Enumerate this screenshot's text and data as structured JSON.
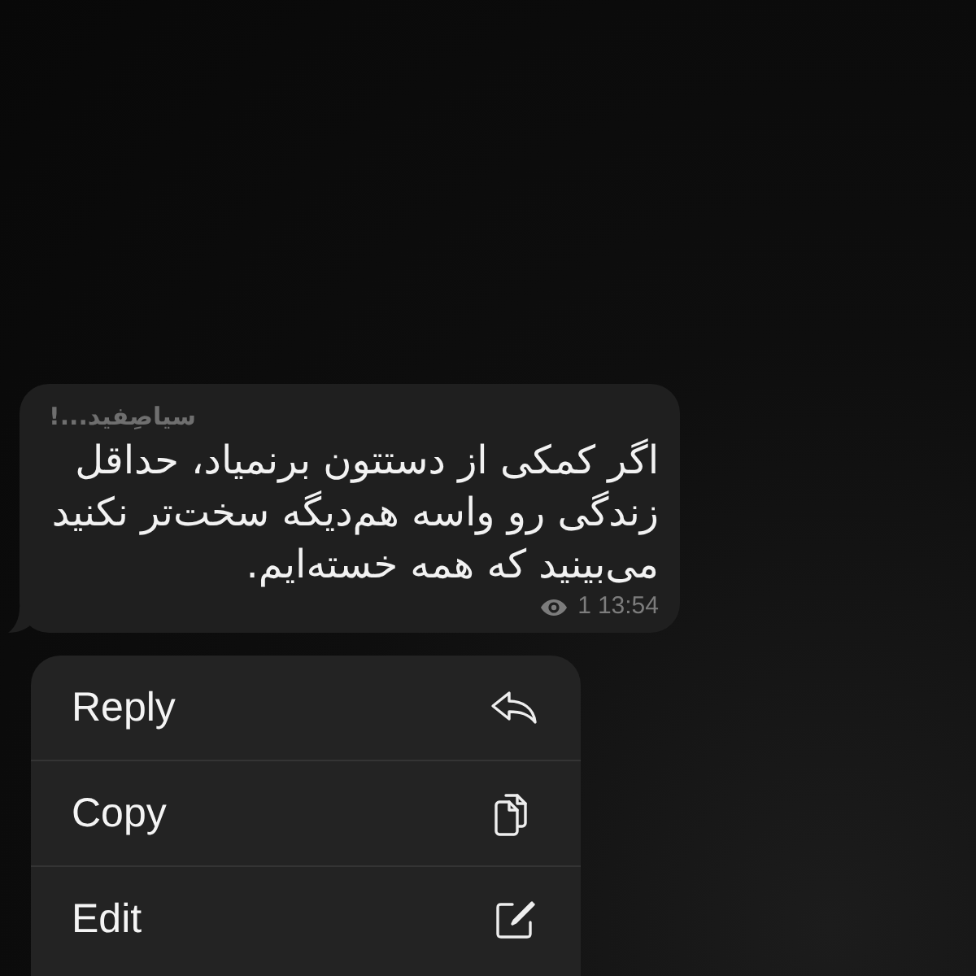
{
  "message": {
    "sender": "سیاصِفید...!",
    "text": "اگر کمکی از دستتون برنمیاد، حداقل\nزندگی رو واسه هم‌دیگه سخت‌تر نکنید\nمی‌بینید که همه خسته‌ایم.",
    "views": "1",
    "time": "13:54"
  },
  "context_menu": {
    "items": [
      {
        "kind": "reply",
        "label": "Reply"
      },
      {
        "kind": "copy",
        "label": "Copy"
      },
      {
        "kind": "edit",
        "label": "Edit"
      }
    ]
  }
}
